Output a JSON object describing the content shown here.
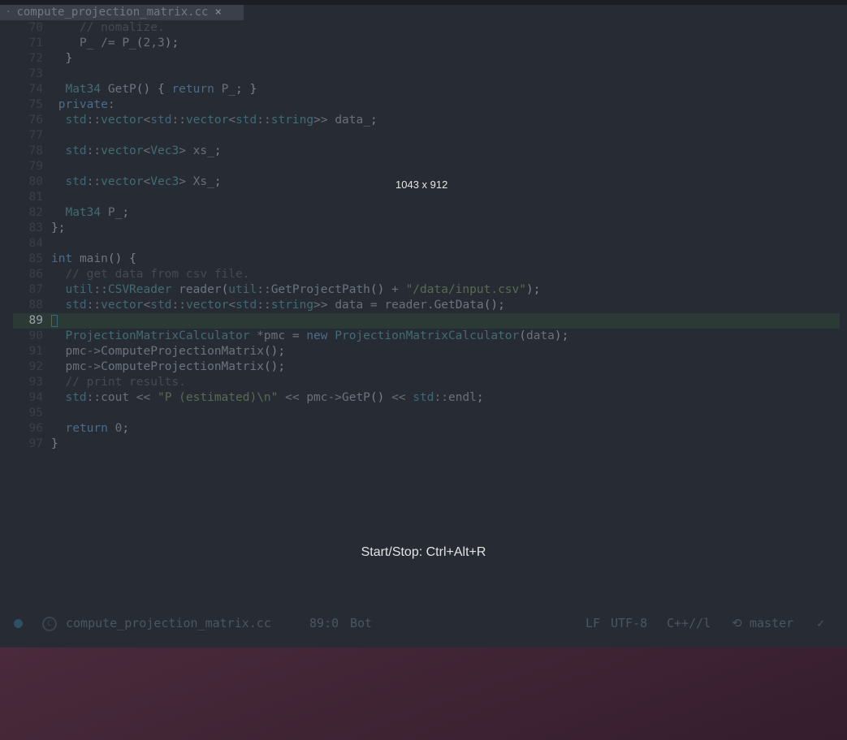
{
  "tab": {
    "title": "compute_projection_matrix.cc",
    "close": "×"
  },
  "overlay": {
    "size_label": "1043 x 912",
    "shortcut": "Start/Stop: Ctrl+Alt+R"
  },
  "status": {
    "filename": "compute_projection_matrix.cc",
    "position": "89:0",
    "scroll": "Bot",
    "line_ending": "LF",
    "encoding": "UTF-8",
    "mode": "C++//l",
    "branch": "master",
    "check": "✓",
    "lang_icon": "C",
    "branch_icon": "⟲"
  },
  "editor": {
    "current_line": 89,
    "lines": [
      {
        "n": "70",
        "t": "    // nomalize."
      },
      {
        "n": "71",
        "t": "    P_ /= P_(2,3);"
      },
      {
        "n": "72",
        "t": "  }"
      },
      {
        "n": "73",
        "t": ""
      },
      {
        "n": "74",
        "t": "  Mat34 GetP() { return P_; }"
      },
      {
        "n": "75",
        "t": " private:"
      },
      {
        "n": "76",
        "t": "  std::vector<std::vector<std::string>> data_;"
      },
      {
        "n": "77",
        "t": ""
      },
      {
        "n": "78",
        "t": "  std::vector<Vec3> xs_;"
      },
      {
        "n": "79",
        "t": ""
      },
      {
        "n": "80",
        "t": "  std::vector<Vec3> Xs_;"
      },
      {
        "n": "81",
        "t": ""
      },
      {
        "n": "82",
        "t": "  Mat34 P_;"
      },
      {
        "n": "83",
        "t": "};"
      },
      {
        "n": "84",
        "t": ""
      },
      {
        "n": "85",
        "t": "int main() {"
      },
      {
        "n": "86",
        "t": "  // get data from csv file."
      },
      {
        "n": "87",
        "t": "  util::CSVReader reader(util::GetProjectPath() + \"/data/input.csv\");"
      },
      {
        "n": "88",
        "t": "  std::vector<std::vector<std::string>> data = reader.GetData();"
      },
      {
        "n": "89",
        "t": ""
      },
      {
        "n": "90",
        "t": "  ProjectionMatrixCalculator *pmc = new ProjectionMatrixCalculator(data);"
      },
      {
        "n": "91",
        "t": "  pmc->ComputeProjectionMatrix();"
      },
      {
        "n": "92",
        "t": "  pmc->ComputeProjectionMatrix();"
      },
      {
        "n": "93",
        "t": "  // print results."
      },
      {
        "n": "94",
        "t": "  std::cout << \"P (estimated)\\n\" << pmc->GetP() << std::endl;"
      },
      {
        "n": "95",
        "t": ""
      },
      {
        "n": "96",
        "t": "  return 0;"
      },
      {
        "n": "97",
        "t": "}"
      }
    ]
  }
}
